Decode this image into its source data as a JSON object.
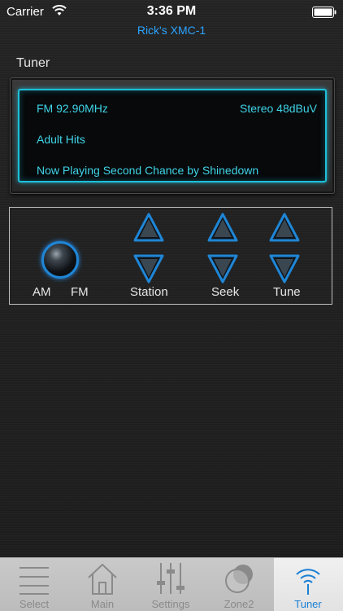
{
  "status_bar": {
    "carrier": "Carrier",
    "time": "3:36 PM"
  },
  "device_name": "Rick's XMC-1",
  "section_title": "Tuner",
  "display": {
    "frequency": "FM  92.90MHz",
    "stereo": "Stereo 48dBuV",
    "genre": "Adult Hits",
    "now_playing": "Now Playing Second Chance by Shinedown"
  },
  "controls": {
    "am_label": "AM",
    "fm_label": "FM",
    "station_label": "Station",
    "seek_label": "Seek",
    "tune_label": "Tune"
  },
  "tabs": [
    {
      "label": "Select",
      "icon": "list-icon",
      "active": false
    },
    {
      "label": "Main",
      "icon": "home-icon",
      "active": false
    },
    {
      "label": "Settings",
      "icon": "sliders-icon",
      "active": false
    },
    {
      "label": "Zone2",
      "icon": "zone-icon",
      "active": false
    },
    {
      "label": "Tuner",
      "icon": "antenna-icon",
      "active": true
    }
  ],
  "colors": {
    "accent": "#2aa4ff",
    "display_text": "#3fd3e6",
    "tab_active": "#1a7fd6"
  }
}
